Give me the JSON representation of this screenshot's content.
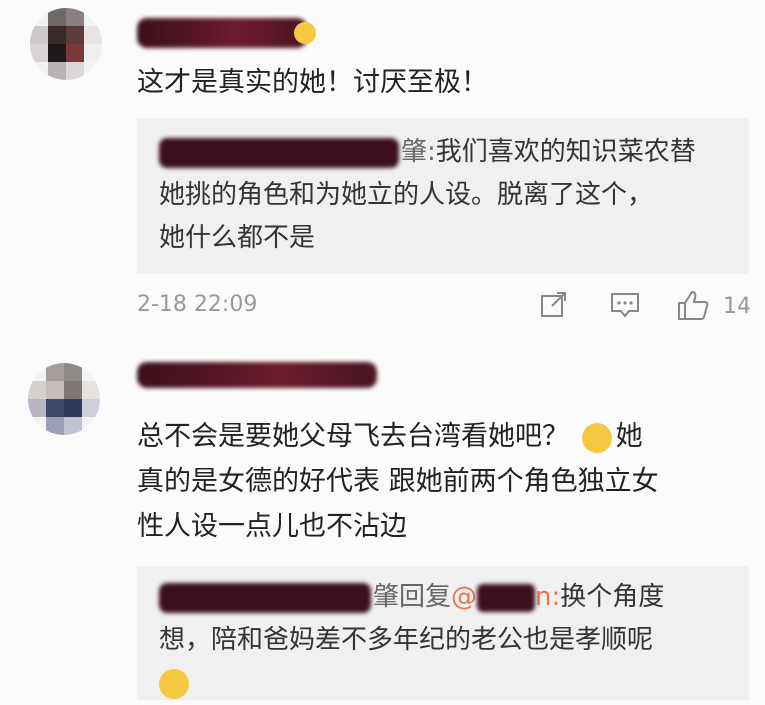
{
  "comment1": {
    "text": "这才是真实的她！讨厌至极！",
    "reply_lines": [
      "我们喜欢的知识菜农替",
      "她挑的角色和为她立的人设。脱离了这个，",
      "她什么都不是"
    ],
    "reply_name_tail": "肇:",
    "timestamp": "2-18 22:09",
    "likes": "14"
  },
  "comment2": {
    "lines": [
      "总不会是要她父母飞去台湾看她吧？",
      "真的是女德的好代表 跟她前两个角色独立女",
      "性人设一点儿也不沾边"
    ],
    "line1_tail": "她",
    "reply_prefix": "肇回复",
    "reply_at": "@",
    "reply_mention_tail": "n:",
    "reply_line1": "换个角度",
    "reply_line2": "想，陪和爸妈差不多年纪的老公也是孝顺呢"
  },
  "icons": [
    "repost-icon",
    "comment-icon",
    "thumbs-up-icon",
    "emoji-sweat-icon",
    "emoji-grin-icon"
  ],
  "colors": {
    "background": "#fbfbfb",
    "quote_bg": "#f0f0f0",
    "meta": "#999999",
    "redaction": "#3b0f1b"
  }
}
